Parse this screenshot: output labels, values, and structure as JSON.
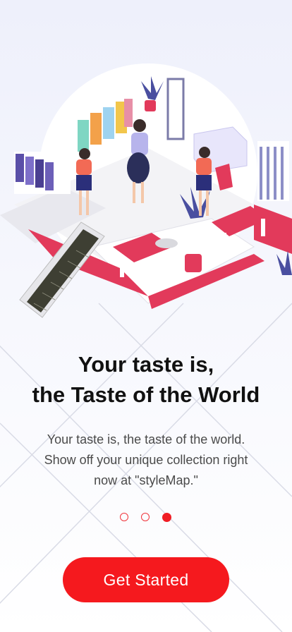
{
  "onboarding": {
    "headline_line1": "Your taste is,",
    "headline_line2": "the Taste of the World",
    "description_line1": "Your taste is, the taste of the world.",
    "description_line2": "Show off your unique collection right",
    "description_line3": "now at \"styleMap.\"",
    "pagination": {
      "total": 3,
      "active_index": 2
    },
    "cta_label": "Get Started"
  },
  "colors": {
    "accent": "#f5191e",
    "text_primary": "#111111",
    "text_secondary": "#4a4a4a",
    "background": "#eef0fb"
  }
}
